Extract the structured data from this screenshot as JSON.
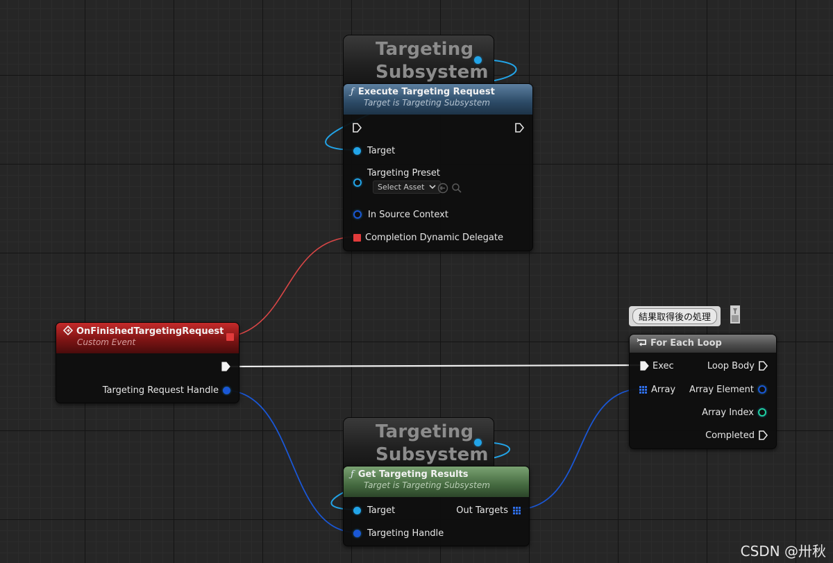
{
  "nodes": {
    "ghost_top": {
      "line1": "Targeting",
      "line2": "Subsystem"
    },
    "execute": {
      "title": "Execute Targeting Request",
      "subtitle": "Target is Targeting Subsystem",
      "pins": {
        "target": "Target",
        "preset": "Targeting Preset",
        "preset_value": "Select Asset",
        "source": "In Source Context",
        "delegate": "Completion Dynamic Delegate"
      }
    },
    "event": {
      "title": "OnFinishedTargetingRequest",
      "subtitle": "Custom Event",
      "pins": {
        "handle": "Targeting Request Handle"
      }
    },
    "foreach": {
      "comment": "結果取得後の処理",
      "title": "For Each Loop",
      "pins": {
        "exec": "Exec",
        "array": "Array",
        "loop_body": "Loop Body",
        "array_element": "Array Element",
        "array_index": "Array Index",
        "completed": "Completed"
      }
    },
    "ghost_bottom": {
      "line1": "Targeting",
      "line2": "Subsystem"
    },
    "getresults": {
      "title": "Get Targeting Results",
      "subtitle": "Target is Targeting Subsystem",
      "pins": {
        "target": "Target",
        "handle": "Targeting Handle",
        "out_targets": "Out Targets"
      }
    }
  },
  "watermark": "CSDN @卅秋",
  "colors": {
    "exec_wire": "#f0f0f0",
    "object_pin": "#22a4e8",
    "struct_pin": "#1a57d6",
    "delegate_pin": "#e23b3b",
    "int_pin": "#1fd0a0"
  }
}
